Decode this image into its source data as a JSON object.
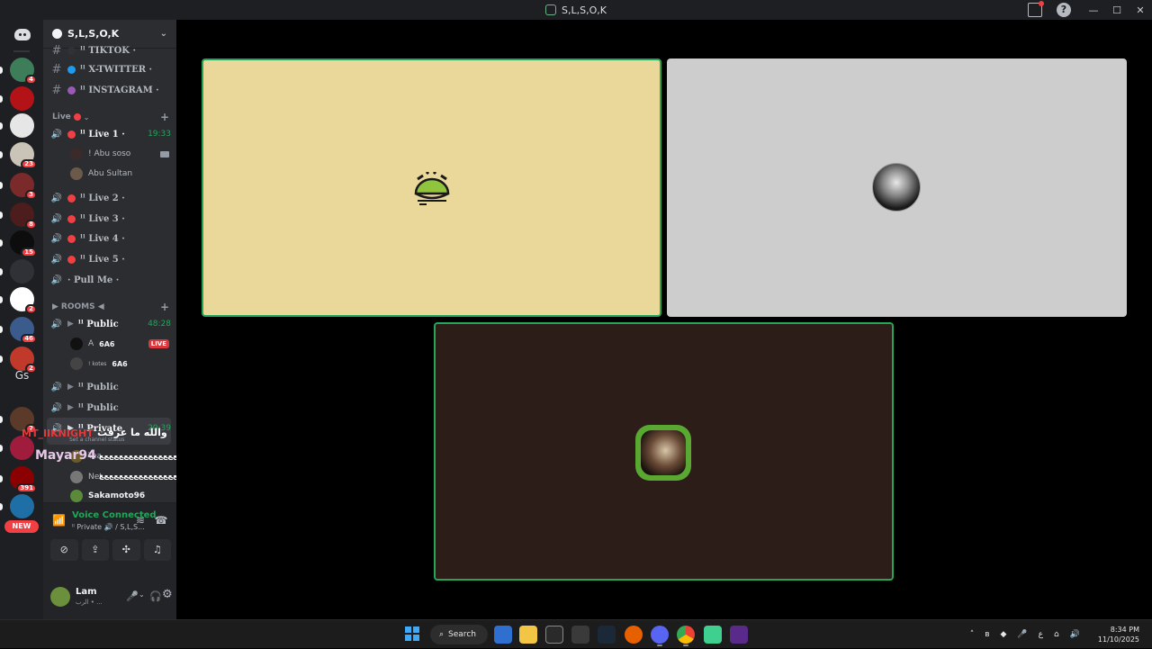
{
  "window": {
    "title": "S,L,S,O,K",
    "controls": [
      "—",
      "☐",
      "✕"
    ]
  },
  "rail": {
    "home_icon": "discord-icon",
    "text_server": "Gs",
    "new_label": "NEW",
    "servers": [
      {
        "color": "#3e7d5a",
        "badge": "4"
      },
      {
        "color": "#b31217",
        "badge": ""
      },
      {
        "color": "#e6e6e6",
        "badge": ""
      },
      {
        "color": "#c9c3b8",
        "badge": "23"
      },
      {
        "color": "#7a2a2a",
        "badge": "3"
      },
      {
        "color": "#4d1c1c",
        "badge": "8"
      },
      {
        "color": "#0d0d0d",
        "badge": "15"
      },
      {
        "color": "#2f3136",
        "badge": ""
      },
      {
        "color": "#ffffff",
        "badge": "2"
      },
      {
        "color": "#3b5b8c",
        "badge": "46"
      },
      {
        "color": "#c0392b",
        "badge": "2"
      },
      {
        "color": "#5b3a2a",
        "badge": "2"
      },
      {
        "color": "#a01c3c",
        "badge": ""
      },
      {
        "color": "#8b0000",
        "badge": "391"
      },
      {
        "color": "#1d6fa5",
        "badge": ""
      }
    ]
  },
  "sidebar": {
    "server_name": "S,L,S,O,K",
    "text_channels": [
      {
        "name": "ˡˡ TIKTOK ·",
        "dot": "#2f3136"
      },
      {
        "name": "ˡˡ X-TWITTER ·",
        "dot": "#1d9bf0"
      },
      {
        "name": "ˡˡ INSTAGRAM ·",
        "dot": "#9b59b6"
      }
    ],
    "live_category": "Live",
    "live_channels": [
      {
        "name": "ˡˡ Live 1 ·",
        "timer": "19:33",
        "active": true
      },
      {
        "name": "ˡˡ Live 2 ·"
      },
      {
        "name": "ˡˡ Live 3 ·"
      },
      {
        "name": "ˡˡ Live 4 ·"
      },
      {
        "name": "ˡˡ Live 5 ·"
      },
      {
        "name": "· Pull Me ·"
      }
    ],
    "live1_users": [
      "! Abu soso",
      "Abu Sultan"
    ],
    "rooms_category": "ROOMS ◀",
    "room_public_1": {
      "name": "ˡˡ Public",
      "timer": "48:28"
    },
    "room_users": [
      {
        "name": "A",
        "tag": "6A6",
        "live": "LIVE"
      },
      {
        "name": "! kotes",
        "tag": "6A6"
      }
    ],
    "room_public_2": "ˡˡ Public",
    "room_public_3": "ˡˡ Public",
    "room_private": {
      "name": "ˡˡ Private",
      "timer": "20:39",
      "status": "Set a channel status"
    },
    "private_users": [
      "Tea",
      "Net",
      "Sakamoto96"
    ]
  },
  "overlays": {
    "arabic_line": "والله ما عرفت",
    "red_name": "MT_IIKNIGHT",
    "mayar_name": "Mayar94",
    "zigzag_1": "ﻊﻊﻊﻊﻊﻊﻊﻊﻊﻊﻊﻊﻊﻊﻊﻊﻊﻊﻊﻊﻊﻊﻊﻊﻊﻊﻊﻊﻊﻊﻊﻊﻊﻊﻊﻊﻊﻊﻊﻊﻊﻊﻊﻊﻊﻊ",
    "zigzag_2": "ﻊﻊﻊﻊﻊﻊﻊﻊﻊﻊﻊﻊﻊﻊﻊﻊﻊﻊﻊﻊﻊﻊﻊﻊﻊﻊ"
  },
  "voice": {
    "status": "Voice Connected",
    "channel": "ˡˡ Private 🔊 / S,L,S..."
  },
  "user": {
    "name": "Lam",
    "status": "الرب • ..."
  },
  "taskbar": {
    "search_label": "Search",
    "time": "8:34 PM",
    "date": "11/10/2025",
    "lang": "ع"
  },
  "colors": {
    "tile_1": "#ead89b",
    "tile_2": "#cdcdcd",
    "tile_3": "#2c1d18",
    "speaking_border": "#23a55a"
  }
}
